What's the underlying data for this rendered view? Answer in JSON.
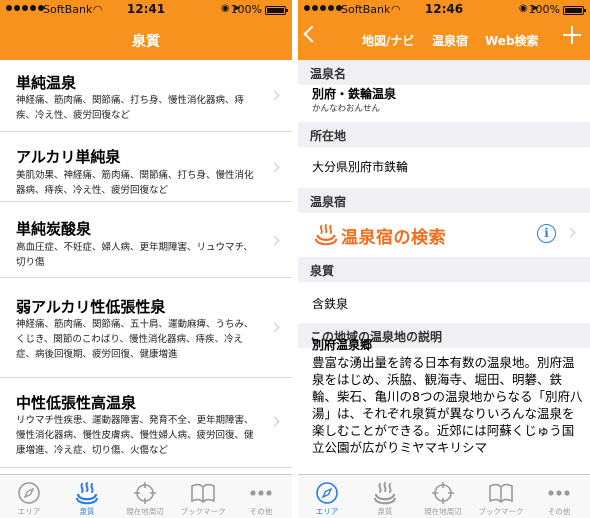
{
  "left": {
    "status": {
      "carrier": "SoftBank",
      "time": "12:41",
      "battery": "100%"
    },
    "title": "泉質",
    "items": [
      {
        "title": "単純温泉",
        "desc": "神経痛、筋肉痛、関節痛、打ち身、慢性消化器病、痔疾、冷え性、疲労回復など"
      },
      {
        "title": "アルカリ単純泉",
        "desc": "美肌効果、神経痛、筋肉痛、関節痛、打ち身、慢性消化器病、痔疾、冷え性、疲労回復など"
      },
      {
        "title": "単純炭酸泉",
        "desc": "高血圧症、不妊症、婦人病、更年期障害、リュウマチ、切り傷"
      },
      {
        "title": "弱アルカリ性低張性泉",
        "desc": "神経痛、筋肉痛、関節痛、五十肩、運動麻痺、うちみ、くじき、関節のこわばり、慢性消化器病、痔疾、冷え症、病後回復期、疲労回復、健康増進"
      },
      {
        "title": "中性低張性高温泉",
        "desc": "リウマチ性疾患、運動器障害、発育不全、更年期障害、慢性消化器病、慢性皮膚病、慢性婦人病、疲労回復、健康増進、冷え症、切り傷、火傷など"
      }
    ],
    "tabs": [
      {
        "label": "エリア",
        "icon": "compass-icon"
      },
      {
        "label": "泉質",
        "icon": "hot-spring-icon"
      },
      {
        "label": "現在地周辺",
        "icon": "location-target-icon"
      },
      {
        "label": "ブックマーク",
        "icon": "book-icon"
      },
      {
        "label": "その他",
        "icon": "more-icon"
      }
    ],
    "active_tab": 1
  },
  "right": {
    "status": {
      "carrier": "SoftBank",
      "time": "12:46",
      "battery": "100%"
    },
    "nav": {
      "map": "地図/ナビ",
      "inn": "温泉宿",
      "web": "Web検索"
    },
    "sections": {
      "name_header": "温泉名",
      "name": "別府・鉄輪温泉",
      "name_reading": "かんなわおんせん",
      "location_header": "所在地",
      "location": "大分県別府市鉄輪",
      "inn_header": "温泉宿",
      "inn_search": "温泉宿の検索",
      "quality_header": "泉質",
      "quality": "含鉄泉",
      "description_header": "この地域の温泉地の説明",
      "description_title": "別府温泉郷",
      "description": "豊富な湧出量を誇る日本有数の温泉地。別府温泉をはじめ、浜脇、観海寺、堀田、明礬、鉄輪、柴石、亀川の8つの温泉地からなる「別府八湯」は、それぞれ泉質が異なりいろんな温泉を楽しむことができる。近郊には阿蘇くじゅう国立公園が広がりミヤマキリシマ"
    },
    "tabs": [
      {
        "label": "エリア",
        "icon": "compass-icon"
      },
      {
        "label": "泉質",
        "icon": "hot-spring-icon"
      },
      {
        "label": "現在地周辺",
        "icon": "location-target-icon"
      },
      {
        "label": "ブックマーク",
        "icon": "book-icon"
      },
      {
        "label": "その他",
        "icon": "more-icon"
      }
    ],
    "active_tab": 0
  },
  "colors": {
    "accent": "#f7921e",
    "tab_active": "#2a7cea",
    "tab_inactive": "#9b9b9b",
    "onsen_logo": "#f36d1c",
    "section_bg": "#efeff4"
  }
}
